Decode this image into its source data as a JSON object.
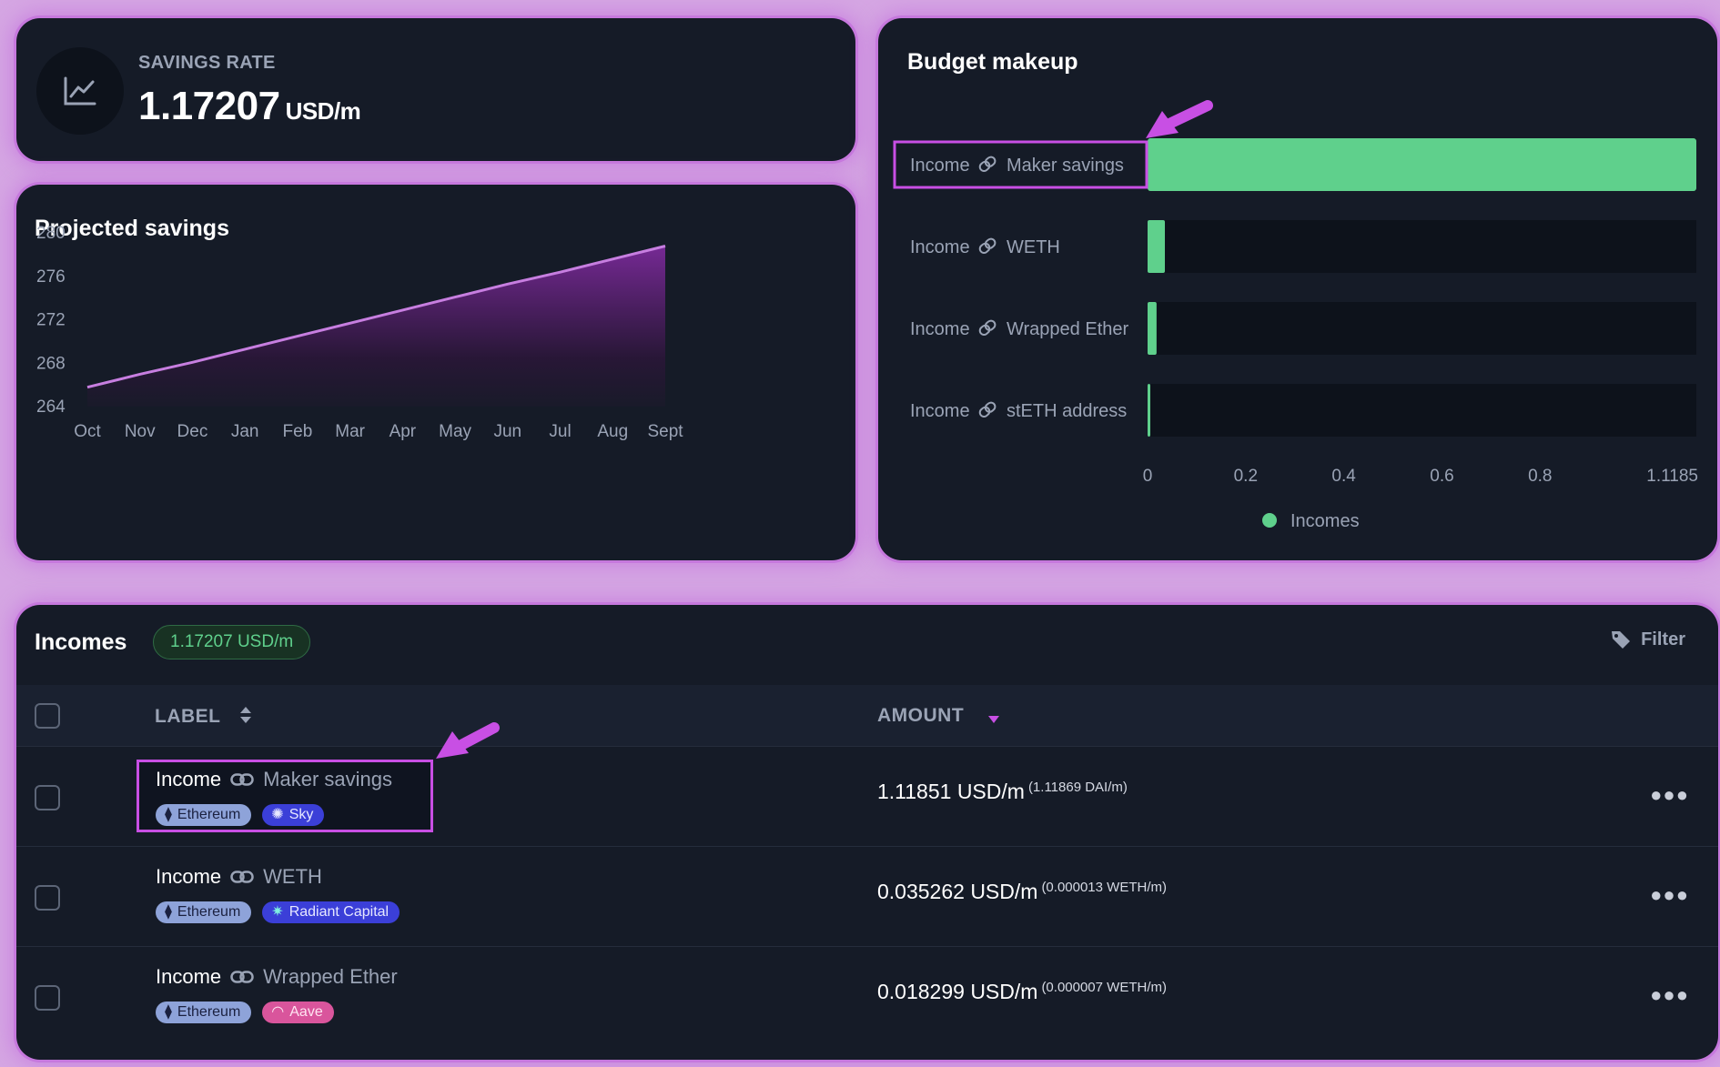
{
  "savings_rate": {
    "label": "SAVINGS RATE",
    "value": "1.17207",
    "unit": "USD/m",
    "icon": "trend-line-icon"
  },
  "projected_savings": {
    "title": "Projected savings",
    "chart_data": {
      "type": "area",
      "title": "Projected savings",
      "x": [
        "Oct",
        "Nov",
        "Dec",
        "Jan",
        "Feb",
        "Mar",
        "Apr",
        "May",
        "Jun",
        "Jul",
        "Aug",
        "Sept"
      ],
      "values": [
        265.7,
        266.9,
        268.0,
        269.2,
        270.4,
        271.6,
        272.8,
        274.0,
        275.2,
        276.3,
        277.5,
        278.7
      ],
      "yticks": [
        280,
        276,
        272,
        268,
        264
      ],
      "ylim": [
        264,
        280
      ],
      "grid": false,
      "colors": {
        "line": "#c77ee0",
        "fill": "#7b2a9a"
      }
    }
  },
  "budget_makeup": {
    "title": "Budget makeup",
    "chart_data": {
      "type": "bar",
      "orientation": "horizontal",
      "title": "Budget makeup",
      "categories": [
        {
          "prefix": "Income",
          "name": "Maker savings",
          "highlighted": true
        },
        {
          "prefix": "Income",
          "name": "WETH",
          "highlighted": false
        },
        {
          "prefix": "Income",
          "name": "Wrapped Ether",
          "highlighted": false
        },
        {
          "prefix": "Income",
          "name": "stETH address",
          "highlighted": false
        }
      ],
      "series": [
        {
          "name": "Incomes",
          "values": [
            1.11851,
            0.035262,
            0.018299,
            0.0017
          ],
          "color": "#5fd08c"
        }
      ],
      "xticks": [
        "0",
        "0.2",
        "0.4",
        "0.6",
        "0.8",
        "1.1185"
      ],
      "xlim": [
        0,
        1.1185
      ],
      "legend_position": "bottom-center"
    }
  },
  "incomes_table": {
    "title": "Incomes",
    "total_pill": "1.17207 USD/m",
    "filter_label": "Filter",
    "columns": {
      "label": "LABEL",
      "amount": "AMOUNT"
    },
    "rows": [
      {
        "prefix": "Income",
        "name": "Maker savings",
        "badges": [
          {
            "text": "Ethereum",
            "kind": "eth"
          },
          {
            "text": "Sky",
            "kind": "blue"
          }
        ],
        "amount": "1.11851 USD/m",
        "amount_detail": "(1.11869 DAI/m)",
        "highlighted": true
      },
      {
        "prefix": "Income",
        "name": "WETH",
        "badges": [
          {
            "text": "Ethereum",
            "kind": "eth"
          },
          {
            "text": "Radiant Capital",
            "kind": "blue"
          }
        ],
        "amount": "0.035262 USD/m",
        "amount_detail": "(0.000013 WETH/m)",
        "highlighted": false
      },
      {
        "prefix": "Income",
        "name": "Wrapped Ether",
        "badges": [
          {
            "text": "Ethereum",
            "kind": "eth"
          },
          {
            "text": "Aave",
            "kind": "pink"
          }
        ],
        "amount": "0.018299 USD/m",
        "amount_detail": "(0.000007 WETH/m)",
        "highlighted": false
      }
    ]
  },
  "accent_colors": {
    "highlight": "#c84fe4",
    "income_green": "#5fd08c",
    "card_bg": "#151b27",
    "page_bg": "#d5a6e3"
  }
}
